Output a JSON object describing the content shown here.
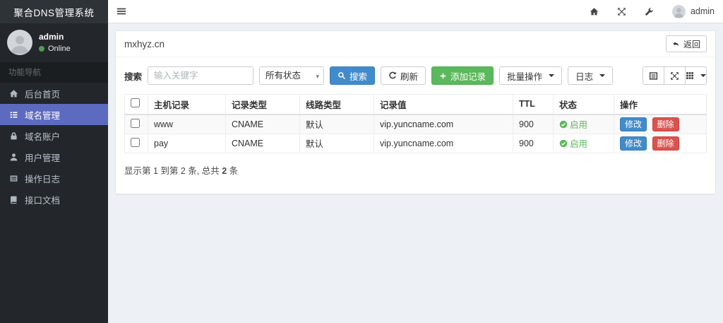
{
  "app": {
    "title": "聚合DNS管理系统"
  },
  "user_panel": {
    "name": "admin",
    "status": "Online"
  },
  "sidebar": {
    "section_label": "功能导航",
    "items": [
      {
        "label": "后台首页",
        "icon": "home-icon",
        "active": false
      },
      {
        "label": "域名管理",
        "icon": "list-icon",
        "active": true
      },
      {
        "label": "域名账户",
        "icon": "lock-icon",
        "active": false
      },
      {
        "label": "用户管理",
        "icon": "user-icon",
        "active": false
      },
      {
        "label": "操作日志",
        "icon": "log-icon",
        "active": false
      },
      {
        "label": "接口文档",
        "icon": "book-icon",
        "active": false
      }
    ]
  },
  "navbar": {
    "username": "admin",
    "icons": [
      "menu-icon",
      "home-icon",
      "fullscreen-icon",
      "wrench-icon",
      "avatar"
    ]
  },
  "page": {
    "domain_title": "mxhyz.cn",
    "back_label": "返回"
  },
  "toolbar": {
    "search_label": "搜索",
    "search_placeholder": "输入关键字",
    "status_filter_selected": "所有状态",
    "search_button": "搜索",
    "refresh_button": "刷新",
    "add_button": "添加记录",
    "batch_button": "批量操作",
    "log_button": "日志",
    "view_icons": [
      "card-view-icon",
      "fullscreen-icon",
      "columns-icon"
    ]
  },
  "table": {
    "headers": [
      "主机记录",
      "记录类型",
      "线路类型",
      "记录值",
      "TTL",
      "状态",
      "操作"
    ],
    "rows": [
      {
        "host": "www",
        "type": "CNAME",
        "line": "默认",
        "value": "vip.yuncname.com",
        "ttl": "900",
        "status": "启用"
      },
      {
        "host": "pay",
        "type": "CNAME",
        "line": "默认",
        "value": "vip.yuncname.com",
        "ttl": "900",
        "status": "启用"
      }
    ],
    "actions": {
      "edit": "修改",
      "delete": "删除"
    }
  },
  "pagination": {
    "prefix": "显示第 1 到第 2 条, 总共 ",
    "total": "2",
    "suffix": " 条"
  },
  "colors": {
    "sidebar_active": "#5c6bc0",
    "primary": "#428bca",
    "success": "#5cb85c",
    "danger": "#d9534f",
    "status_enabled": "#5cb85c"
  }
}
